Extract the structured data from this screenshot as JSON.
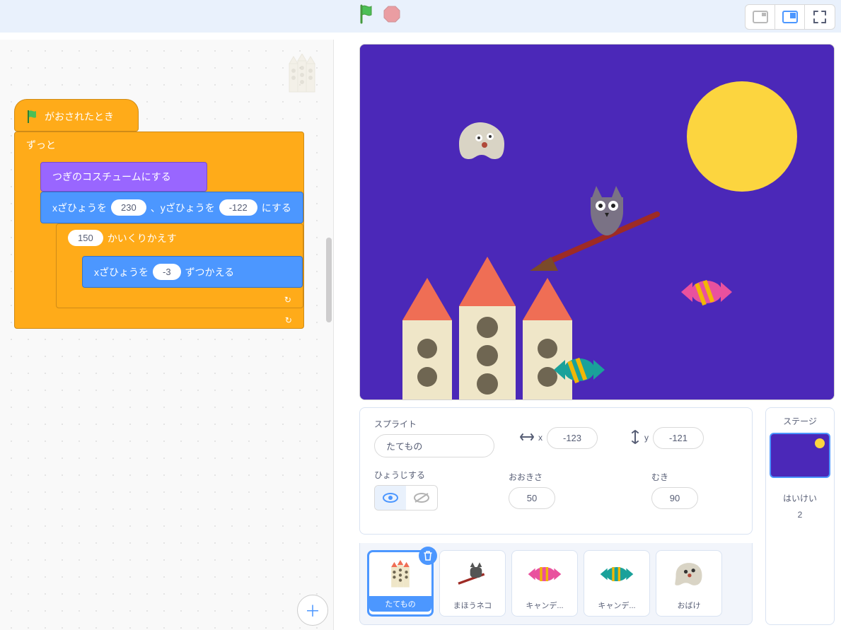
{
  "topbar": {
    "flag": "green-flag",
    "stop": "stop-sign"
  },
  "blocks": {
    "hat_label": "がおされたとき",
    "forever_label": "ずっと",
    "next_costume": "つぎのコスチュームにする",
    "goto_pre": "xざひょうを",
    "goto_x": "230",
    "goto_mid": "、yざひょうを",
    "goto_y": "-122",
    "goto_post": "にする",
    "repeat_count": "150",
    "repeat_label": "かいくりかえす",
    "changex_pre": "xざひょうを",
    "changex_val": "-3",
    "changex_post": "ずつかえる"
  },
  "info": {
    "sprite_label": "スプライト",
    "sprite_name": "たてもの",
    "x_label": "x",
    "x_value": "-123",
    "y_label": "y",
    "y_value": "-121",
    "show_label": "ひょうじする",
    "size_label": "おおきさ",
    "size_value": "50",
    "direction_label": "むき",
    "direction_value": "90"
  },
  "sprites": [
    {
      "name": "たてもの",
      "selected": true
    },
    {
      "name": "まほうネコ",
      "selected": false
    },
    {
      "name": "キャンデ...",
      "selected": false
    },
    {
      "name": "キャンデ...",
      "selected": false
    },
    {
      "name": "おばけ",
      "selected": false
    }
  ],
  "stage_panel": {
    "title": "ステージ",
    "backdrops_label": "はいけい",
    "backdrops_count": "2"
  }
}
